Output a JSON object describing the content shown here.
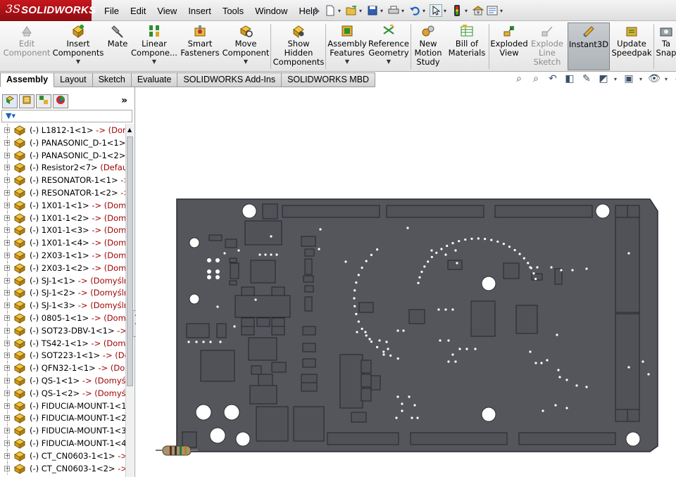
{
  "app": {
    "logo_prefix": "3S",
    "logo_name": "SOLIDWORKS"
  },
  "menu": [
    "File",
    "Edit",
    "View",
    "Insert",
    "Tools",
    "Window",
    "Help"
  ],
  "quick_access": [
    "pin-icon",
    "new-document-icon",
    "open-folder-icon",
    "save-icon",
    "print-icon",
    "undo-icon",
    "select-cursor-icon",
    "traffic-light-icon",
    "options-icon",
    "file-properties-icon"
  ],
  "command_manager": {
    "tools": [
      {
        "id": "edit-component",
        "label": "Edit\nComponent",
        "icon": "edit-component-icon",
        "enabled": false,
        "dropdown": false
      },
      {
        "id": "insert-components",
        "label": "Insert\nComponents",
        "icon": "insert-components-icon",
        "enabled": true,
        "dropdown": true
      },
      {
        "id": "mate",
        "label": "Mate",
        "icon": "mate-icon",
        "enabled": true,
        "dropdown": false
      },
      {
        "id": "linear-component-pattern",
        "label": "Linear\nCompone...",
        "icon": "linear-pattern-icon",
        "enabled": true,
        "dropdown": true
      },
      {
        "id": "smart-fasteners",
        "label": "Smart\nFasteners",
        "icon": "smart-fasteners-icon",
        "enabled": true,
        "dropdown": false
      },
      {
        "id": "move-component",
        "label": "Move\nComponent",
        "icon": "move-component-icon",
        "enabled": true,
        "dropdown": true
      },
      {
        "id": "show-hidden-components",
        "label": "Show\nHidden\nComponents",
        "icon": "show-hidden-icon",
        "enabled": true,
        "dropdown": false
      },
      {
        "id": "assembly-features",
        "label": "Assembly\nFeatures",
        "icon": "assembly-features-icon",
        "enabled": true,
        "dropdown": true
      },
      {
        "id": "reference-geometry",
        "label": "Reference\nGeometry",
        "icon": "reference-geometry-icon",
        "enabled": true,
        "dropdown": true
      },
      {
        "id": "new-motion-study",
        "label": "New\nMotion\nStudy",
        "icon": "motion-study-icon",
        "enabled": true,
        "dropdown": false
      },
      {
        "id": "bill-of-materials",
        "label": "Bill of\nMaterials",
        "icon": "bom-icon",
        "enabled": true,
        "dropdown": false
      },
      {
        "id": "exploded-view",
        "label": "Exploded\nView",
        "icon": "exploded-view-icon",
        "enabled": true,
        "dropdown": false
      },
      {
        "id": "explode-line-sketch",
        "label": "Explode\nLine\nSketch",
        "icon": "explode-line-icon",
        "enabled": false,
        "dropdown": false
      },
      {
        "id": "instant3d",
        "label": "Instant3D",
        "icon": "instant3d-icon",
        "enabled": true,
        "dropdown": false
      },
      {
        "id": "update-speedpak",
        "label": "Update\nSpeedpak",
        "icon": "speedpak-icon",
        "enabled": true,
        "dropdown": false
      },
      {
        "id": "take-snapshot",
        "label": "Ta\nSnap",
        "icon": "snapshot-icon",
        "enabled": true,
        "dropdown": false
      }
    ]
  },
  "tabs": [
    {
      "label": "Assembly",
      "active": true
    },
    {
      "label": "Layout",
      "active": false
    },
    {
      "label": "Sketch",
      "active": false
    },
    {
      "label": "Evaluate",
      "active": false
    },
    {
      "label": "SOLIDWORKS Add-Ins",
      "active": false
    },
    {
      "label": "SOLIDWORKS MBD",
      "active": false
    }
  ],
  "view_tools": [
    "zoom-to-fit-icon",
    "zoom-to-area-icon",
    "previous-view-icon",
    "section-view-icon",
    "dynamic-annotation-icon",
    "view-orientation-icon",
    "display-style-icon",
    "hide-show-items-icon",
    "appearance-icon"
  ],
  "feature_manager": {
    "tab_icons": [
      "feature-tree-icon",
      "property-manager-icon",
      "configuration-manager-icon",
      "display-manager-icon"
    ],
    "more_label": "»",
    "filter_icon": "filter-icon",
    "tree": [
      {
        "prefix": "(-) ",
        "name": "L1812-1<1>",
        "ref": " -> (Domy"
      },
      {
        "prefix": "(-) ",
        "name": "PANASONIC_D-1<1>",
        "ref": " -"
      },
      {
        "prefix": "(-) ",
        "name": "PANASONIC_D-1<2>",
        "ref": " -"
      },
      {
        "prefix": "(-) ",
        "name": "Resistor2<7>",
        "ref": " (Default<"
      },
      {
        "prefix": "(-) ",
        "name": "RESONATOR-1<1>",
        "ref": " ->"
      },
      {
        "prefix": "(-) ",
        "name": "RESONATOR-1<2>",
        "ref": " ->"
      },
      {
        "prefix": "(-) ",
        "name": "1X01-1<1>",
        "ref": " -> (Domyś"
      },
      {
        "prefix": "(-) ",
        "name": "1X01-1<2>",
        "ref": " -> (Domyś"
      },
      {
        "prefix": "(-) ",
        "name": "1X01-1<3>",
        "ref": " -> (Domyś"
      },
      {
        "prefix": "(-) ",
        "name": "1X01-1<4>",
        "ref": " -> (Domyś"
      },
      {
        "prefix": "(-) ",
        "name": "2X03-1<1>",
        "ref": " -> (Domyś"
      },
      {
        "prefix": "(-) ",
        "name": "2X03-1<2>",
        "ref": " -> (Domyś"
      },
      {
        "prefix": "(-) ",
        "name": "SJ-1<1>",
        "ref": " -> (Domyślna"
      },
      {
        "prefix": "(-) ",
        "name": "SJ-1<2>",
        "ref": " -> (Domyślna"
      },
      {
        "prefix": "(-) ",
        "name": "SJ-1<3>",
        "ref": " -> (Domyślna"
      },
      {
        "prefix": "(-) ",
        "name": "0805-1<1>",
        "ref": " -> (Domyśl"
      },
      {
        "prefix": "(-) ",
        "name": "SOT23-DBV-1<1>",
        "ref": " -> (I"
      },
      {
        "prefix": "(-) ",
        "name": "TS42-1<1>",
        "ref": " -> (Domyś"
      },
      {
        "prefix": "(-) ",
        "name": "SOT223-1<1>",
        "ref": " -> (Dom"
      },
      {
        "prefix": "(-) ",
        "name": "QFN32-1<1>",
        "ref": " -> (Dom"
      },
      {
        "prefix": "(-) ",
        "name": "QS-1<1>",
        "ref": " -> (Domyśln"
      },
      {
        "prefix": "(-) ",
        "name": "QS-1<2>",
        "ref": " -> (Domyśln"
      },
      {
        "prefix": "(-) ",
        "name": "FIDUCIA-MOUNT-1<1",
        "ref": ""
      },
      {
        "prefix": "(-) ",
        "name": "FIDUCIA-MOUNT-1<2",
        "ref": ""
      },
      {
        "prefix": "(-) ",
        "name": "FIDUCIA-MOUNT-1<3",
        "ref": ""
      },
      {
        "prefix": "(-) ",
        "name": "FIDUCIA-MOUNT-1<4",
        "ref": ""
      },
      {
        "prefix": "(-) ",
        "name": "CT_CN0603-1<1>",
        "ref": " -> (I"
      },
      {
        "prefix": "(-) ",
        "name": "CT_CN0603-1<2>",
        "ref": " -> (I"
      }
    ]
  },
  "graphics": {
    "model": "pcb-board-assembly",
    "board_color": "#54565c",
    "pad_color": "#4a4c52"
  }
}
